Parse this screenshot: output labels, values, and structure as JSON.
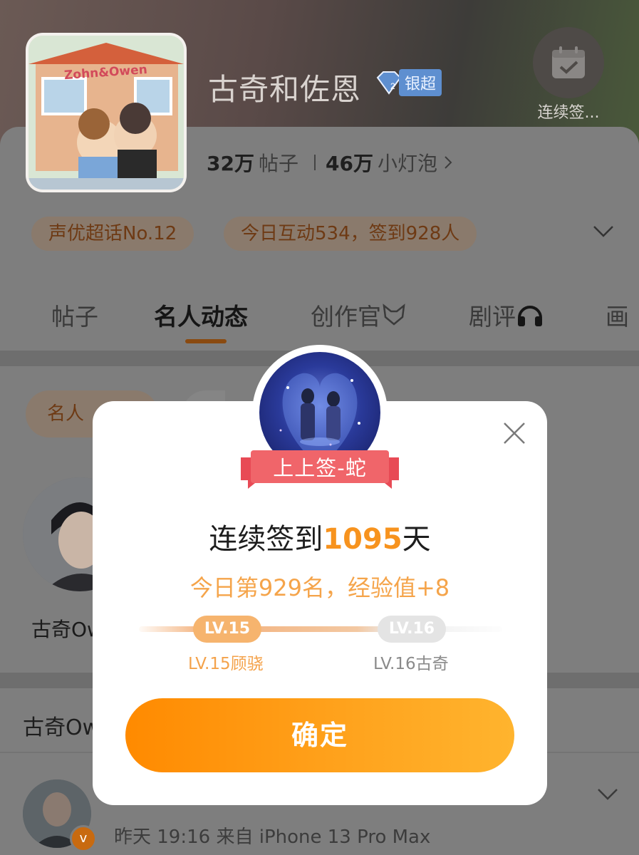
{
  "header": {
    "title": "古奇和佐恩",
    "badge_label": "银超",
    "sign_button_label": "连续签...",
    "avatar_text": "Zohn&Owen"
  },
  "stats": {
    "posts_value": "32万",
    "posts_label": "帖子",
    "bulbs_value": "46万",
    "bulbs_label": "小灯泡"
  },
  "chips": {
    "rank": "声优超话No.12",
    "activity": "今日互动534，签到928人"
  },
  "tabs": [
    {
      "label": "帖子"
    },
    {
      "label": "名人动态"
    },
    {
      "label": "创作官"
    },
    {
      "label": "剧评"
    },
    {
      "label": "画"
    }
  ],
  "filter_chip": "名人",
  "person_name": "古奇Ow",
  "section_title": "古奇Ow",
  "post": {
    "meta": "昨天 19:16   来自 iPhone 13 Pro Max",
    "vbadge": "v"
  },
  "modal": {
    "ribbon": "上上签-蛇",
    "title_prefix": "连续签到",
    "title_days": "1095",
    "title_suffix": "天",
    "subtitle": "今日第929名，经验值+8",
    "current_level": "LV.15",
    "next_level": "LV.16",
    "current_level_label": "LV.15顾骁",
    "next_level_label": "LV.16古奇",
    "confirm": "确定"
  },
  "colors": {
    "accent": "#f7931e",
    "button_start": "#ff8a00",
    "button_end": "#ffb42e",
    "ribbon": "#f0656a",
    "badge_blue": "#5e8fd0"
  }
}
